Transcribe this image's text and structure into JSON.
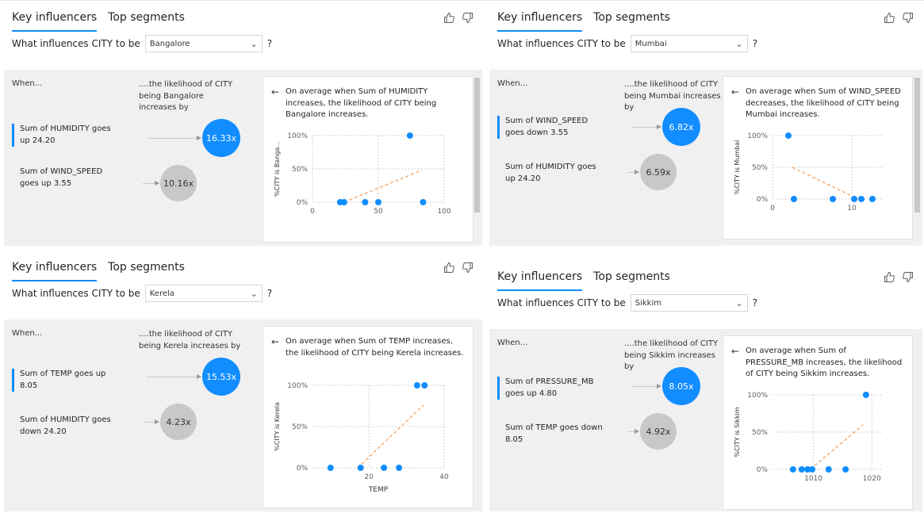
{
  "visuals": [
    {
      "tabs": [
        "Key influencers",
        "Top segments"
      ],
      "question": "What influences CITY to be",
      "selected_value": "Bangalore",
      "qmark": "?",
      "when": "When...",
      "likelihood_header": "....the likelihood of CITY being Bangalore increases by",
      "influencers": [
        {
          "label": "Sum of HUMIDITY goes up 24.20",
          "value": "16.33x",
          "selected": true
        },
        {
          "label": "Sum of WIND_SPEED goes up 3.55",
          "value": "10.16x",
          "selected": false
        }
      ],
      "detail_text": "On average when Sum of HUMIDITY increases, the likelihood of CITY being Bangalore increases.",
      "chart_data": {
        "type": "scatter",
        "ylabel": "%CITY is Banga...",
        "xlabel": "",
        "xlim": [
          0,
          100
        ],
        "ylim": [
          0,
          100
        ],
        "xticks": [
          "0",
          "50",
          "100"
        ],
        "yticks": [
          "100%",
          "50%",
          "0%"
        ],
        "points": [
          [
            21,
            0
          ],
          [
            24,
            0
          ],
          [
            40,
            0
          ],
          [
            50,
            0
          ],
          [
            74,
            100
          ],
          [
            84,
            0
          ]
        ],
        "trend": [
          [
            24,
            0
          ],
          [
            83,
            48
          ]
        ]
      }
    },
    {
      "tabs": [
        "Key influencers",
        "Top segments"
      ],
      "question": "What influences CITY to be",
      "selected_value": "Mumbai",
      "qmark": "?",
      "when": "When...",
      "likelihood_header": "....the likelihood of CITY being Mumbai increases by",
      "influencers": [
        {
          "label": "Sum of WIND_SPEED goes down 3.55",
          "value": "6.82x",
          "selected": true
        },
        {
          "label": "Sum of HUMIDITY goes up 24.20",
          "value": "6.59x",
          "selected": false
        }
      ],
      "detail_text": "On average when Sum of WIND_SPEED decreases, the likelihood of CITY being Mumbai increases.",
      "chart_data": {
        "type": "scatter",
        "ylabel": "%CITY is Mumbai",
        "xlabel": "",
        "xlim": [
          0,
          14
        ],
        "ylim": [
          0,
          100
        ],
        "xticks": [
          "0",
          "10"
        ],
        "yticks": [
          "100%",
          "50%",
          "0%"
        ],
        "points": [
          [
            2,
            100
          ],
          [
            2.7,
            0
          ],
          [
            7.6,
            0
          ],
          [
            10.3,
            0
          ],
          [
            11.2,
            0
          ],
          [
            12.6,
            0
          ]
        ],
        "trend": [
          [
            2.5,
            50
          ],
          [
            10.8,
            0
          ]
        ]
      }
    },
    {
      "tabs": [
        "Key influencers",
        "Top segments"
      ],
      "question": "What influences CITY to be",
      "selected_value": "Kerela",
      "qmark": "?",
      "when": "When...",
      "likelihood_header": "....the likelihood of CITY being Kerela increases by",
      "influencers": [
        {
          "label": "Sum of TEMP goes up 8.05",
          "value": "15.53x",
          "selected": true
        },
        {
          "label": "Sum of HUMIDITY goes down 24.20",
          "value": "4.23x",
          "selected": false
        }
      ],
      "detail_text": "On average when Sum of TEMP increases, the likelihood of CITY being Kerela increases.",
      "chart_data": {
        "type": "scatter",
        "ylabel": "%CITY is Kerela",
        "xlabel": "TEMP",
        "xlim": [
          5,
          40
        ],
        "ylim": [
          0,
          100
        ],
        "xticks": [
          "20",
          "40"
        ],
        "yticks": [
          "100%",
          "50%",
          "0%"
        ],
        "points": [
          [
            9.8,
            0
          ],
          [
            17.8,
            0
          ],
          [
            24,
            0
          ],
          [
            28,
            0
          ],
          [
            32.8,
            100
          ],
          [
            34.8,
            100
          ]
        ],
        "trend": [
          [
            17,
            0
          ],
          [
            34.5,
            76
          ]
        ]
      }
    },
    {
      "tabs": [
        "Key influencers",
        "Top segments"
      ],
      "question": "What influences CITY to be",
      "selected_value": "Sikkim",
      "qmark": "?",
      "when": "When...",
      "likelihood_header": "....the likelihood of CITY being Sikkim increases by",
      "influencers": [
        {
          "label": "Sum of PRESSURE_MB goes up 4.80",
          "value": "8.05x",
          "selected": true
        },
        {
          "label": "Sum of TEMP goes down 8.05",
          "value": "4.92x",
          "selected": false
        }
      ],
      "detail_text": "On average when Sum of PRESSURE_MB increases, the likelihood of CITY being Sikkim increases.",
      "chart_data": {
        "type": "scatter",
        "ylabel": "%CITY is Sikkim",
        "xlabel": "",
        "xlim": [
          1003,
          1022
        ],
        "ylim": [
          0,
          100
        ],
        "xticks": [
          "1010",
          "1020"
        ],
        "yticks": [
          "100%",
          "50%",
          "0%"
        ],
        "points": [
          [
            1006.5,
            0
          ],
          [
            1008,
            0
          ],
          [
            1009,
            0
          ],
          [
            1009.8,
            0
          ],
          [
            1012.6,
            0
          ],
          [
            1015.5,
            0
          ],
          [
            1019,
            100
          ]
        ],
        "trend": [
          [
            1009.5,
            0
          ],
          [
            1018.5,
            60
          ]
        ]
      }
    }
  ]
}
